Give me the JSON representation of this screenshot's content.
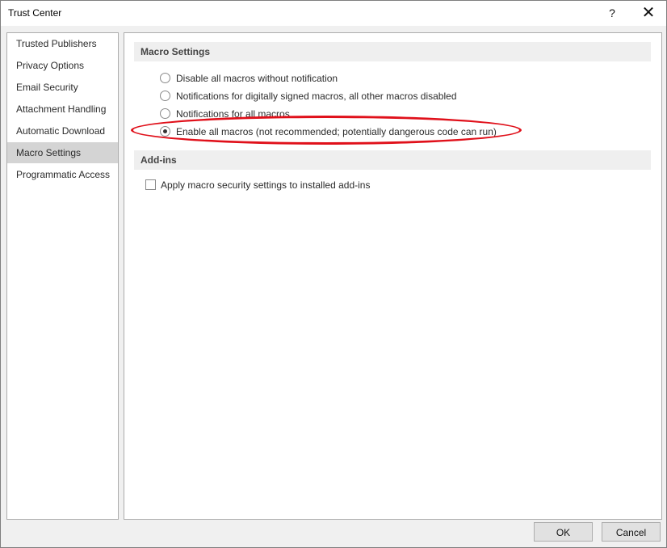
{
  "window": {
    "title": "Trust Center",
    "help_label": "?",
    "close_label": "✕"
  },
  "sidebar": {
    "selected": "Macro Settings",
    "items": [
      {
        "label": "Trusted Publishers"
      },
      {
        "label": "Privacy Options"
      },
      {
        "label": "Email Security"
      },
      {
        "label": "Attachment Handling"
      },
      {
        "label": "Automatic Download"
      },
      {
        "label": "Macro Settings"
      },
      {
        "label": "Programmatic Access"
      }
    ]
  },
  "macro_settings": {
    "header": "Macro Settings",
    "options": [
      {
        "label": "Disable all macros without notification",
        "checked": false
      },
      {
        "label": "Notifications for digitally signed macros, all other macros disabled",
        "checked": false
      },
      {
        "label": "Notifications for all macros",
        "checked": false
      },
      {
        "label": "Enable all macros (not recommended; potentially dangerous code can run)",
        "checked": true
      }
    ],
    "highlight_color": "#e0101a"
  },
  "addins": {
    "header": "Add-ins",
    "checkbox_label": "Apply macro security settings to installed add-ins",
    "checked": false
  },
  "footer": {
    "ok_label": "OK",
    "cancel_label": "Cancel"
  }
}
